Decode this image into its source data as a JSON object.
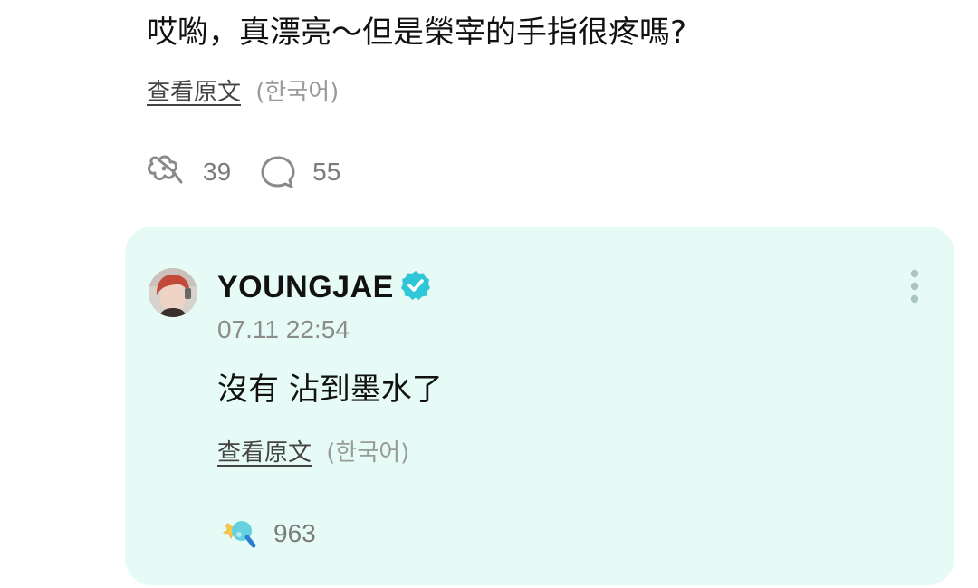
{
  "comment": {
    "text": "哎喲，真漂亮～但是榮宰的手指很疼嗎?",
    "view_original": "查看原文",
    "language": "(한국어)",
    "like_count": "39",
    "reply_count": "55"
  },
  "reply": {
    "author": "YOUNGJAE",
    "timestamp": "07.11 22:54",
    "text": "沒有 沾到墨水了",
    "view_original": "查看原文",
    "language": "(한국어)",
    "like_count": "963"
  },
  "colors": {
    "card_background": "#e6fbf6",
    "verified_badge": "#2fc7d8",
    "muted_text": "#8c8c8c"
  },
  "icons": {
    "like": "clover-like-icon",
    "comment": "speech-bubble-icon",
    "verified": "verified-badge-icon",
    "more": "vertical-ellipsis-icon",
    "liked": "liked-clover-icon"
  }
}
